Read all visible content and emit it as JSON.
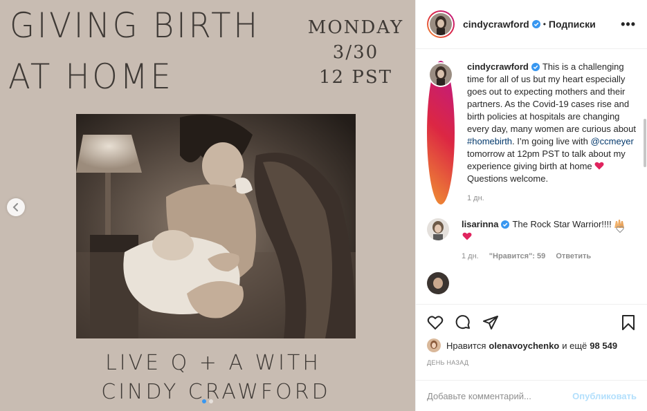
{
  "post_image": {
    "title_line1": "GIVING BIRTH",
    "title_line2": "AT HOME",
    "date_line1": "MONDAY",
    "date_line2": "3/30",
    "date_line3": "12 PST",
    "bottom_line1": "LIVE Q + A WITH",
    "bottom_line2": "CINDY CRAWFORD",
    "carousel_count": 2,
    "carousel_active": 0
  },
  "header": {
    "username": "cindycrawford",
    "separator": "•",
    "follow_label": "Подписки",
    "more_label": "•••"
  },
  "caption": {
    "username": "cindycrawford",
    "text_before_hashtag": "This is a challenging time for all of us but my heart especially goes out to expecting mothers and their partners. As the Covid-19 cases rise and birth policies at hospitals are changing every day, many women are curious about ",
    "hashtag": "#homebirth",
    "text_mid": ". I’m going live with ",
    "mention": "@ccmeyer",
    "text_after": " tomorrow at 12pm PST to talk about my experience giving birth at home ",
    "text_end": " Questions welcome.",
    "time": "1 дн."
  },
  "comments": [
    {
      "username": "lisarinna",
      "text": "The Rock Star Warrior!!!! ",
      "time": "1 дн.",
      "likes": "\"Нравится\": 59",
      "reply_label": "Ответить"
    }
  ],
  "actions": {
    "likes_prefix": "Нравится",
    "likes_user": "olenavoychenko",
    "likes_mid": "и ещё",
    "likes_count": "98 549",
    "date": "ДЕНЬ НАЗАД"
  },
  "add_comment": {
    "placeholder": "Добавьте комментарий...",
    "post_label": "Опубликовать"
  },
  "colors": {
    "media_bg": "#c8bcb2",
    "verified": "#3897f0",
    "link": "#00376b",
    "post_disabled": "#b2dffc"
  }
}
